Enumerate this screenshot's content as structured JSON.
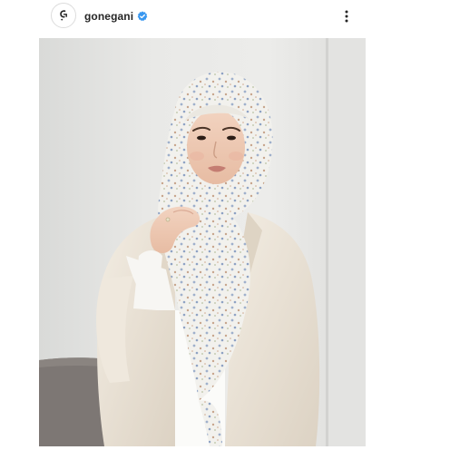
{
  "post": {
    "username": "gonegani",
    "verified": true,
    "avatar_icon": "brand-logo-icon",
    "more_icon": "more-vertical-icon",
    "image_description_icon": "photo-hijab-woman"
  },
  "colors": {
    "username": "#262626",
    "verified_badge": "#3897f0",
    "background": "#ffffff",
    "photo_wall": "#e6e6e4",
    "blazer": "#ece4d7",
    "scarf": "#f1f0ec"
  }
}
